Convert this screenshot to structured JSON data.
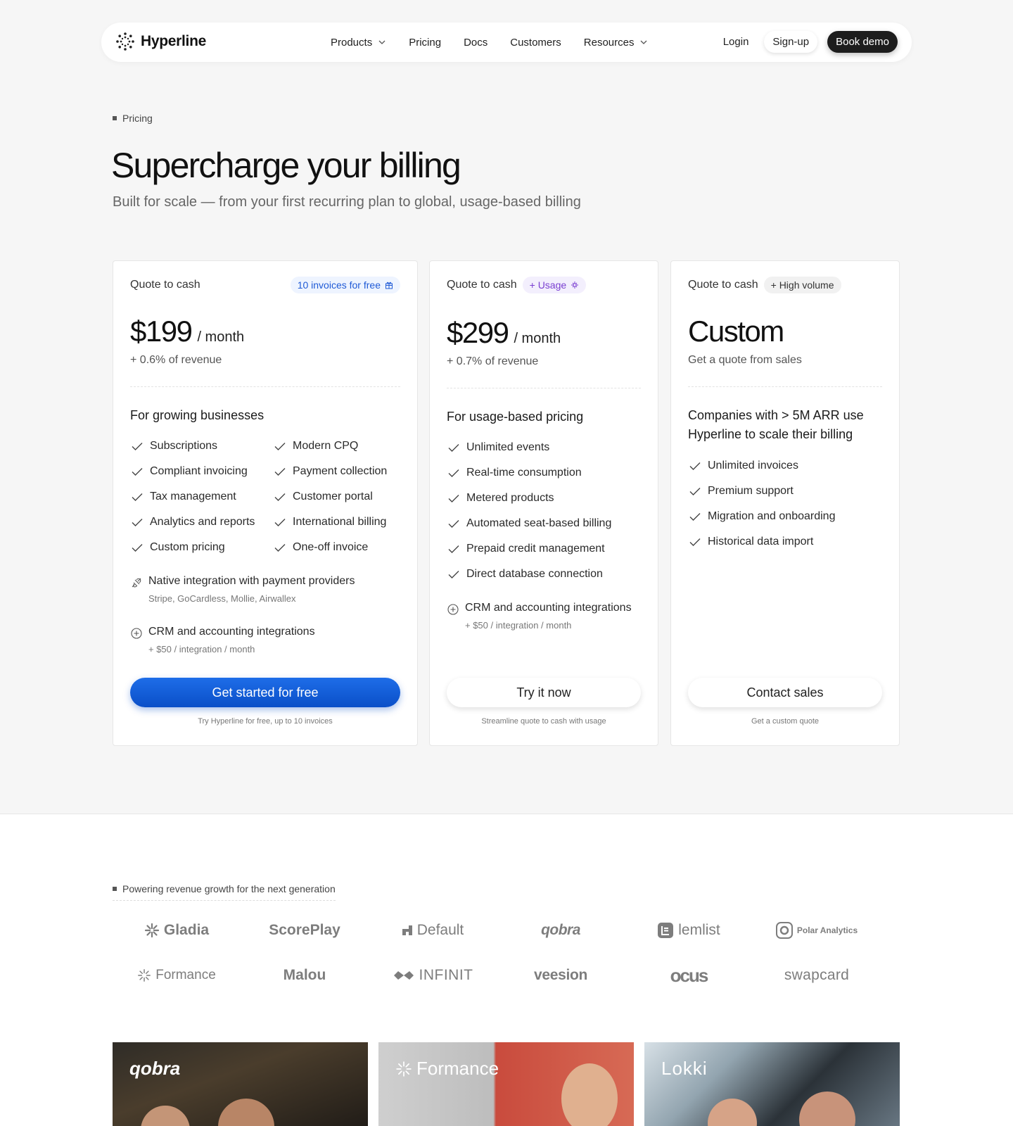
{
  "nav": {
    "logo_text": "Hyperline",
    "menu": [
      {
        "label": "Products",
        "has_dropdown": true
      },
      {
        "label": "Pricing",
        "has_dropdown": false
      },
      {
        "label": "Docs",
        "has_dropdown": false
      },
      {
        "label": "Customers",
        "has_dropdown": false
      },
      {
        "label": "Resources",
        "has_dropdown": true
      }
    ],
    "login": "Login",
    "signup": "Sign-up",
    "book_demo": "Book demo"
  },
  "hero": {
    "eyebrow": "Pricing",
    "title": "Supercharge your billing",
    "subtitle": "Built for scale — from your first recurring plan to global, usage-based billing"
  },
  "plans": [
    {
      "label": "Quote to cash",
      "badge": "10 invoices for free",
      "badge_icon": "gift-icon",
      "price": "$199",
      "period": "/ month",
      "revenue": "+ 0.6% of revenue",
      "for": "For growing businesses",
      "features": [
        "Subscriptions",
        "Modern CPQ",
        "Compliant invoicing",
        "Payment collection",
        "Tax management",
        "Customer portal",
        "Analytics and reports",
        "International billing",
        "Custom pricing",
        "One-off invoice"
      ],
      "extras": [
        {
          "icon": "plug-icon",
          "title": "Native integration with payment providers",
          "sub": "Stripe, GoCardless, Mollie, Airwallex"
        },
        {
          "icon": "plus-circle-icon",
          "title": "CRM and accounting integrations",
          "sub": "+ $50 / integration / month"
        }
      ],
      "cta": "Get started for free",
      "cta_note": "Try Hyperline for free, up to 10 invoices"
    },
    {
      "label": "Quote to cash",
      "badge": "+ Usage",
      "badge_icon": "usage-icon",
      "price": "$299",
      "period": "/ month",
      "revenue": "+ 0.7% of revenue",
      "for": "For usage-based pricing",
      "features": [
        "Unlimited events",
        "Real-time consumption",
        "Metered products",
        "Automated seat-based billing",
        "Prepaid credit management",
        "Direct database connection"
      ],
      "extras": [
        {
          "icon": "plus-circle-icon",
          "title": "CRM and accounting integrations",
          "sub": "+ $50 / integration / month"
        }
      ],
      "cta": "Try it now",
      "cta_note": "Streamline quote to cash with usage"
    },
    {
      "label": "Quote to cash",
      "badge": "+ High volume",
      "price": "Custom",
      "revenue": "Get a quote from sales",
      "for": "Companies with > 5M ARR use Hyperline to scale their billing",
      "features": [
        "Unlimited invoices",
        "Premium support",
        "Migration and onboarding",
        "Historical data import"
      ],
      "cta": "Contact sales",
      "cta_note": "Get a custom quote"
    }
  ],
  "customers": {
    "eyebrow": "Powering revenue growth for the next generation",
    "logos": [
      "Gladia",
      "ScorePlay",
      "Default",
      "qobra",
      "lemlist",
      "Polar Analytics",
      "Formance",
      "Malou",
      "INFINIT",
      "veesion",
      "ocus",
      "swapcard"
    ],
    "stories": [
      "qobra",
      "Formance",
      "Lokki"
    ]
  },
  "colors": {
    "accent_blue": "#0a4fc8",
    "badge_blue": "#1f5ad6",
    "badge_purple": "#7a3fd1",
    "dark_button": "#1d1d1d",
    "page_bg": "#f6f6f6"
  }
}
